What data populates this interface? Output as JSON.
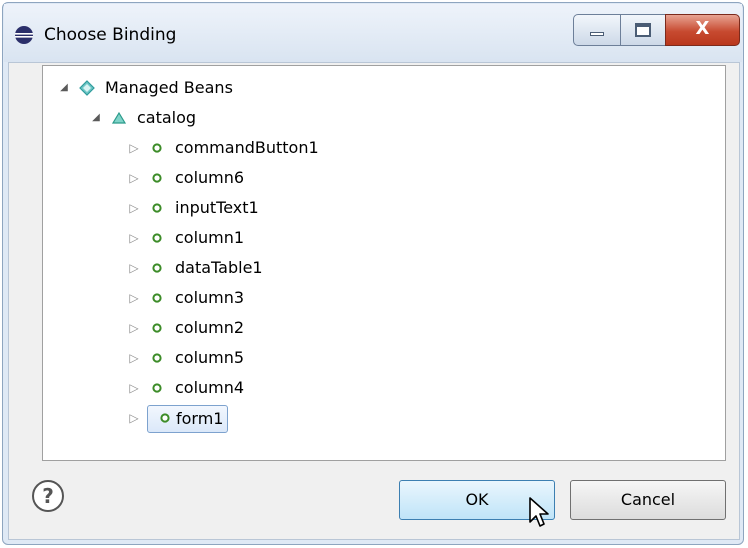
{
  "window": {
    "title": "Choose Binding",
    "close_glyph": "X"
  },
  "tree": {
    "root": {
      "label": "Managed Beans",
      "icon": "managed-beans-diamond-icon"
    },
    "bean": {
      "label": "catalog",
      "icon": "bean-triangle-icon"
    },
    "children": [
      {
        "label": "commandButton1"
      },
      {
        "label": "column6"
      },
      {
        "label": "inputText1"
      },
      {
        "label": "column1"
      },
      {
        "label": "dataTable1"
      },
      {
        "label": "column3"
      },
      {
        "label": "column2"
      },
      {
        "label": "column5"
      },
      {
        "label": "column4"
      },
      {
        "label": "form1",
        "selected": true
      }
    ]
  },
  "buttons": {
    "help_glyph": "?",
    "ok_label": "OK",
    "cancel_label": "Cancel"
  },
  "colors": {
    "selection_border": "#7da2ce",
    "property_icon": "#3c8c28",
    "root_icon": "#2e9c9c"
  }
}
